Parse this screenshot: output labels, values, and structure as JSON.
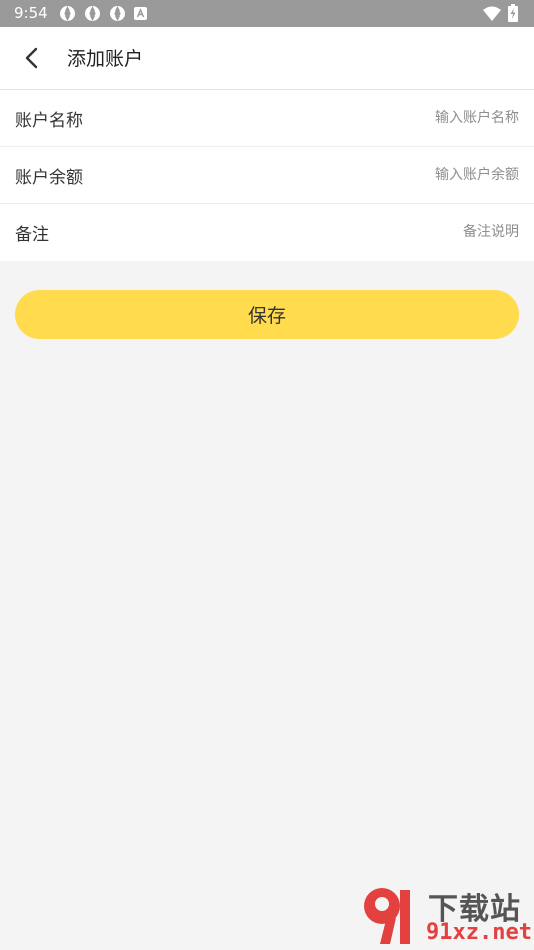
{
  "status_bar": {
    "time": "9:54",
    "icons": [
      "notification-icon",
      "notification-icon",
      "notification-icon",
      "keyboard-a-icon"
    ],
    "right_icons": [
      "wifi-icon",
      "battery-charging-icon"
    ]
  },
  "header": {
    "back_icon": "chevron-left-icon",
    "title": "添加账户"
  },
  "form": {
    "rows": [
      {
        "label": "账户名称",
        "placeholder": "输入账户名称",
        "value": ""
      },
      {
        "label": "账户余额",
        "placeholder": "输入账户余额",
        "value": ""
      },
      {
        "label": "备注",
        "placeholder": "备注说明",
        "value": ""
      }
    ]
  },
  "save_button": {
    "label": "保存"
  },
  "colors": {
    "accent": "#ffdb4d",
    "background": "#f4f4f4",
    "status_bar": "#9a9a9a"
  },
  "watermark": {
    "text_top": "下载站",
    "text_bottom": "91xz.net"
  }
}
